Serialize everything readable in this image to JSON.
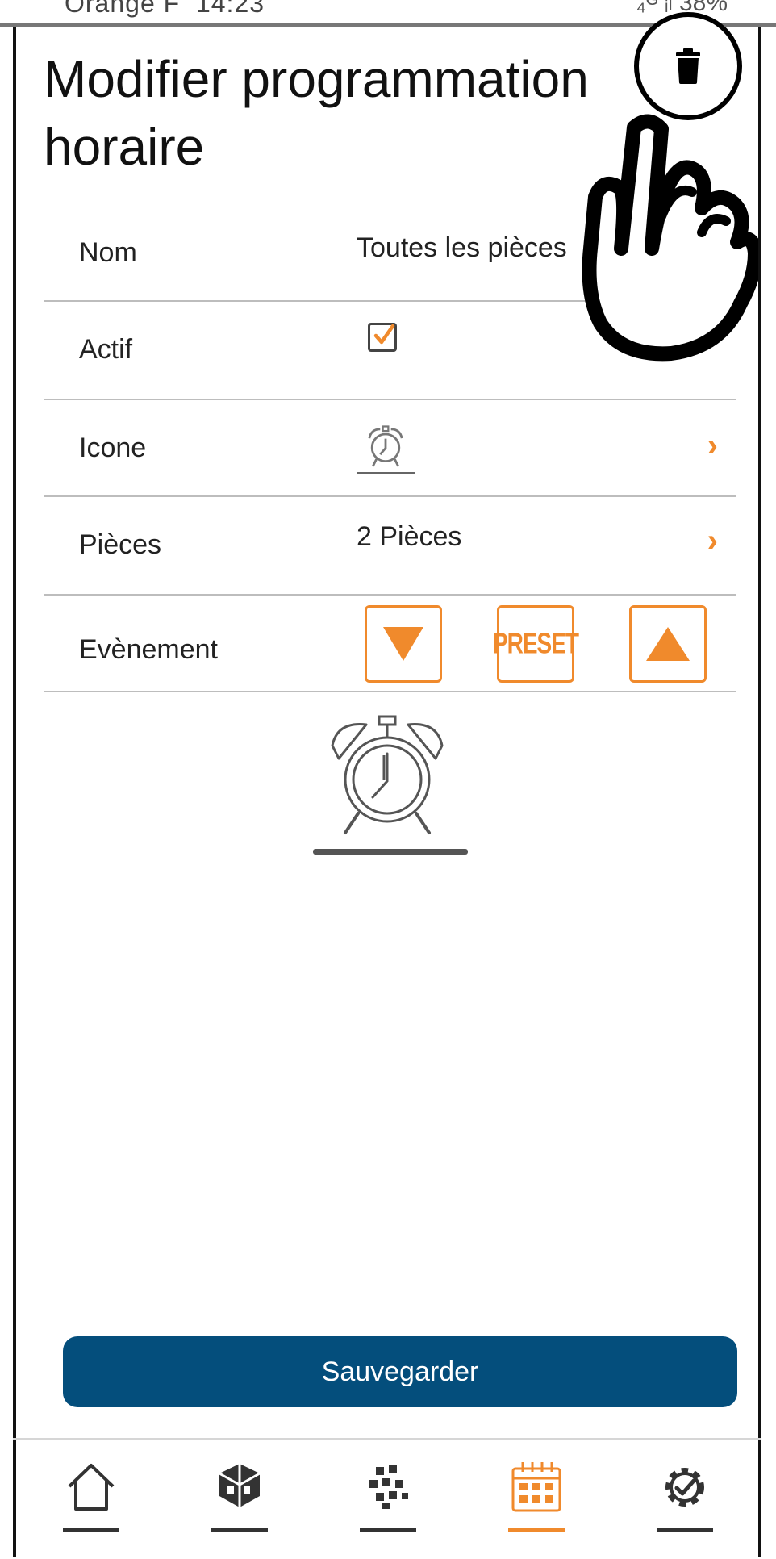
{
  "status_bar": {
    "carrier": "Orange F",
    "time": "14:23",
    "right": "₄ᴳ ᵢₗ 38%"
  },
  "page": {
    "title": "Modifier programmation horaire"
  },
  "icons": {
    "delete": "trash-icon",
    "pointer": "pointing-hand-icon"
  },
  "form": {
    "nom": {
      "label": "Nom",
      "value": "Toutes les pièces"
    },
    "actif": {
      "label": "Actif",
      "checked": true
    },
    "icone": {
      "label": "Icone",
      "icon": "alarm-clock-icon"
    },
    "pieces": {
      "label": "Pièces",
      "value": "2 Pièces"
    },
    "evenement": {
      "label": "Evènement",
      "preset_label": "PRESET",
      "buttons": [
        "down-triangle-icon",
        "preset-icon",
        "up-triangle-icon"
      ]
    }
  },
  "selected_icon": "alarm-clock-icon",
  "save_button": {
    "label": "Sauvegarder"
  },
  "bottom_nav": [
    {
      "name": "home-icon",
      "active": false
    },
    {
      "name": "rooms-icon",
      "active": false
    },
    {
      "name": "devices-icon",
      "active": false
    },
    {
      "name": "calendar-icon",
      "active": true
    },
    {
      "name": "settings-icon",
      "active": false
    }
  ],
  "colors": {
    "accent": "#f08a2c",
    "primary": "#044e7c",
    "divider": "#bdbdbd",
    "text": "#1b1b1b"
  }
}
